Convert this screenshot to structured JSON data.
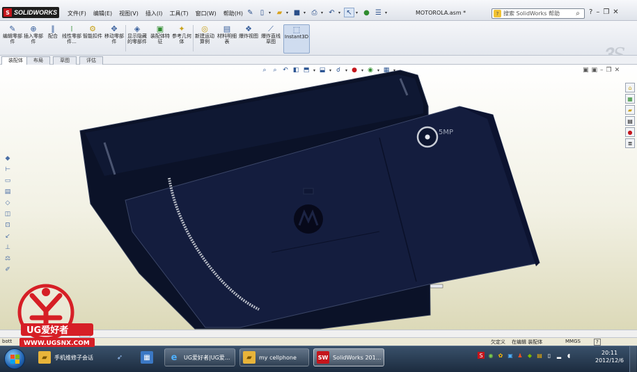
{
  "app": {
    "brand": "SOLIDWORKS",
    "document_title": "MOTOROLA.asm *",
    "menus": [
      "文件(F)",
      "编辑(E)",
      "视图(V)",
      "插入(I)",
      "工具(T)",
      "窗口(W)",
      "帮助(H)"
    ],
    "help_search_placeholder": "搜索 SolidWorks 帮助"
  },
  "command_manager": {
    "tools": [
      {
        "label": "编辑零部件",
        "icon": "edit-component-icon"
      },
      {
        "label": "插入零部件",
        "icon": "insert-component-icon"
      },
      {
        "label": "配合",
        "icon": "mate-icon"
      },
      {
        "label": "线性零部件...",
        "icon": "linear-pattern-icon"
      },
      {
        "label": "智能扣件",
        "icon": "smart-fastener-icon"
      },
      {
        "label": "移动零部件",
        "icon": "move-component-icon"
      },
      {
        "label": "显示隐藏的零部件",
        "icon": "show-hidden-icon"
      },
      {
        "label": "装配体特征",
        "icon": "assembly-feature-icon"
      },
      {
        "label": "参考几何体",
        "icon": "reference-geometry-icon"
      },
      {
        "label": "新建运动算例",
        "icon": "motion-study-icon"
      },
      {
        "label": "材料明细表",
        "icon": "bom-icon"
      },
      {
        "label": "爆炸视图",
        "icon": "exploded-view-icon"
      },
      {
        "label": "爆炸直线草图",
        "icon": "explode-line-sketch-icon"
      },
      {
        "label": "Instant3D",
        "icon": "instant3d-icon"
      }
    ],
    "tabs": [
      "装配体",
      "布局",
      "草图",
      "评估"
    ],
    "active_tab": "装配体"
  },
  "viewport": {
    "model": "MOTOROLA.asm",
    "background_top": "#ffffff",
    "background_bottom": "#dcd9b8",
    "body_color": "#0d1530",
    "cover_color": "#141d3e",
    "camera_label": "5MP"
  },
  "bottom": {
    "model_tab": "1",
    "status_left": "bott",
    "status_undefined": "欠定义",
    "status_editing": "在编辑 装配体",
    "units": "MMGS"
  },
  "taskbar": {
    "items": [
      {
        "label": "手机维修子会话",
        "icon": "folder-icon"
      },
      {
        "label": "",
        "icon": "bird-app-icon"
      },
      {
        "label": "",
        "icon": "app-grid-icon"
      },
      {
        "label": "UG爱好者|UG爱...",
        "icon": "ie-icon"
      },
      {
        "label": "my cellphone",
        "icon": "folder-icon"
      },
      {
        "label": "SolidWorks 201...",
        "icon": "solidworks-icon"
      }
    ],
    "time": "20:11",
    "date": "2012/12/6"
  },
  "watermark": {
    "line1": "UG爱好者",
    "line2": "WWW.UGSNX.COM"
  },
  "colors": {
    "accent": "#c4151c",
    "taskbar": "#1c2c3f"
  }
}
